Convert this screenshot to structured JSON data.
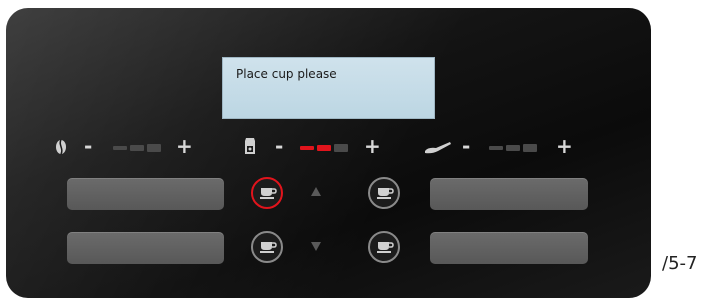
{
  "display": {
    "message": "Place cup please"
  },
  "controls": {
    "strength": {
      "icon": "coffee-bean-icon",
      "minus": "-",
      "plus": "+",
      "level_segments_active": 0,
      "segments": 3
    },
    "quantity": {
      "icon": "coffee-container-icon",
      "minus": "-",
      "plus": "+",
      "level_segments_active": 2,
      "segments": 3
    },
    "milk": {
      "icon": "milk-spout-icon",
      "minus": "-",
      "plus": "+",
      "level_segments_active": 0,
      "segments": 3
    }
  },
  "buttons": {
    "top_center_left": {
      "icon": "cup-icon",
      "active": true
    },
    "top_center_right": {
      "icon": "cup-icon",
      "active": false
    },
    "bottom_center_left": {
      "icon": "cup-icon",
      "active": false
    },
    "bottom_center_right": {
      "icon": "cup-icon",
      "active": false
    },
    "arrow_up": {
      "icon": "triangle-up-icon"
    },
    "arrow_down": {
      "icon": "triangle-down-icon"
    }
  },
  "colors": {
    "accent_red": "#e1141c",
    "display_bg": "#c8dde8",
    "panel": "#111111"
  },
  "footnote": "/5-7"
}
